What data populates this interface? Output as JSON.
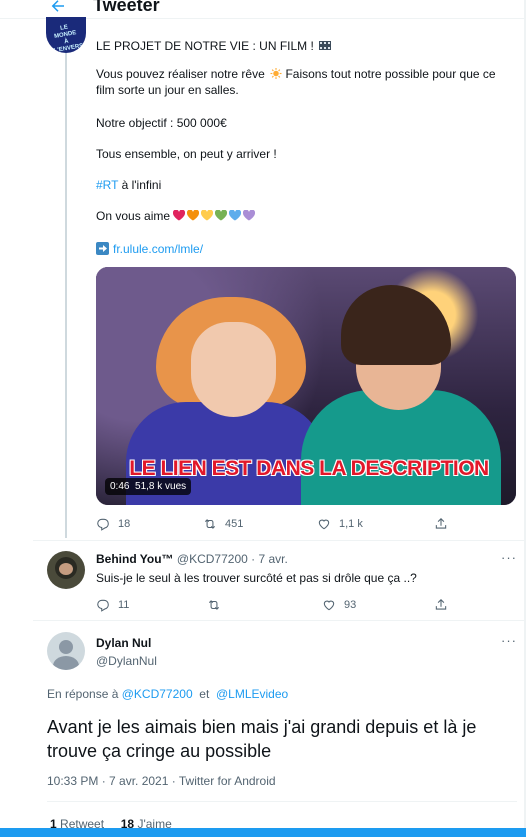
{
  "header": {
    "title": "Tweeter"
  },
  "main_tweet": {
    "line1": "LE PROJET DE NOTRE VIE : UN FILM !",
    "line2": "Vous pouvez réaliser notre rêve",
    "line2b": "Faisons tout notre possible pour que ce",
    "line3": "film sorte un jour en salles.",
    "goal": "Notre objectif : 500 000€",
    "together": "Tous ensemble, on peut y arriver !",
    "hashtag": "#RT",
    "hashtag_rest": " à l'infini",
    "love": "On vous aime",
    "heart_colors": [
      "#e0245e",
      "#f4900c",
      "#ffcc4d",
      "#77b255",
      "#5dadec",
      "#aa8ed6"
    ],
    "link": "fr.ulule.com/lmle/",
    "video": {
      "caption": "LE LIEN EST DANS LA DESCRIPTION",
      "duration": "0:46",
      "views": "51,8 k vues"
    },
    "replies": "18",
    "retweets": "451",
    "likes": "1,1 k"
  },
  "reply": {
    "name": "Behind You™",
    "handle": "@KCD77200",
    "date": "· 7 avr.",
    "text": "Suis-je le seul à les trouver surcôté et pas si drôle que ça ..?",
    "replies": "11",
    "likes": "93"
  },
  "focus_tweet": {
    "name": "Dylan Nul",
    "handle": "@DylanNul",
    "reply_prefix": "En réponse à",
    "reply_to_1": "@KCD77200",
    "reply_and": "et",
    "reply_to_2": "@LMLEvideo",
    "text": "Avant je les aimais bien mais j'ai grandi depuis et là je trouve ça cringe au possible",
    "timestamp": "10:33 PM · 7 avr. 2021 · Twitter for Android",
    "retweet_count": "1",
    "retweet_label": "Retweet",
    "like_count": "18",
    "like_label": "J'aime"
  },
  "colors": {
    "accent": "#1d9bf0",
    "muted": "#536471"
  },
  "icons": [
    "back-arrow-icon",
    "film-icon",
    "sun-icon",
    "heart-icon",
    "arrow-right-icon",
    "reply-icon",
    "retweet-icon",
    "like-icon",
    "share-icon",
    "more-icon"
  ]
}
